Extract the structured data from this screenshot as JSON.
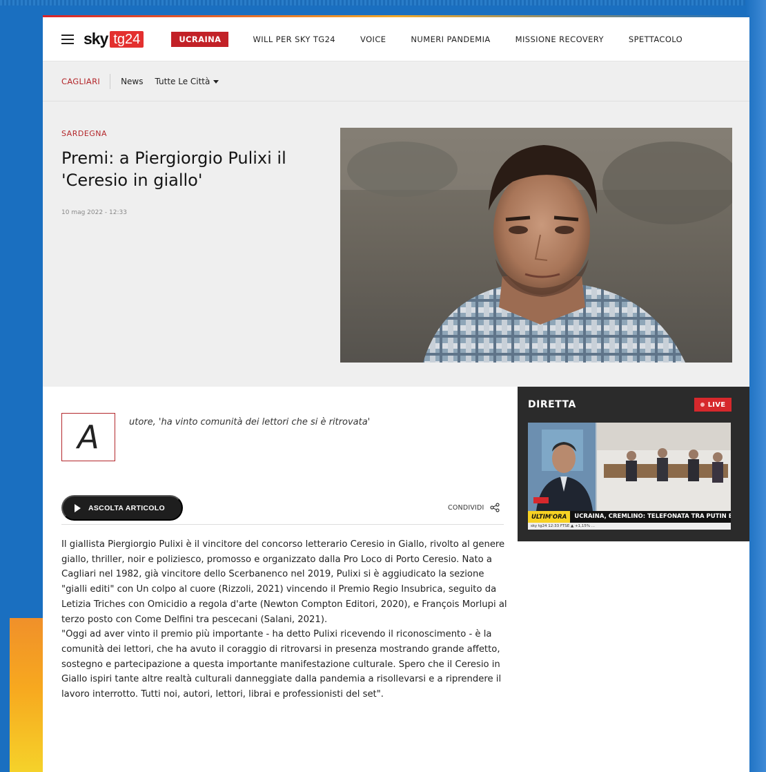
{
  "nav": {
    "logo_sky": "sky",
    "logo_tg": "tg24",
    "items": [
      {
        "label": "UCRAINA"
      },
      {
        "label": "WILL PER SKY TG24"
      },
      {
        "label": "VOICE"
      },
      {
        "label": "NUMERI PANDEMIA"
      },
      {
        "label": "MISSIONE RECOVERY"
      },
      {
        "label": "SPETTACOLO"
      }
    ]
  },
  "subnav": {
    "city": "CAGLIARI",
    "news": "News",
    "cities": "Tutte Le Città"
  },
  "article": {
    "kicker": "SARDEGNA",
    "title": "Premi: a Piergiorgio Pulixi il 'Ceresio in giallo'",
    "date": "10 mag 2022 - 12:33",
    "dropcap": "A",
    "summary": "utore, 'ha vinto comunità dei lettori che si è ritrovata'",
    "listen_label": "ASCOLTA ARTICOLO",
    "share_label": "CONDIVIDI",
    "paragraphs": [
      "Il giallista Piergiorgio Pulixi è il vincitore del concorso letterario Ceresio in Giallo, rivolto al genere giallo, thriller, noir e poliziesco, promosso e organizzato dalla Pro Loco di Porto Ceresio. Nato a Cagliari nel 1982, già vincitore dello Scerbanenco nel 2019, Pulixi si è aggiudicato la sezione \"gialli editi\" con Un colpo al cuore (Rizzoli, 2021) vincendo il Premio Regio Insubrica, seguito da Letizia Triches con Omicidio a regola d'arte (Newton Compton Editori, 2020), e François Morlupi al terzo posto con Come Delfini tra pescecani (Salani, 2021).",
      "\"Oggi ad aver vinto il premio più importante - ha detto Pulixi ricevendo il riconoscimento - è la comunità dei lettori, che ha avuto il coraggio di ritrovarsi in presenza mostrando grande affetto, sostegno e partecipazione a questa importante manifestazione culturale. Spero che il Ceresio in Giallo ispiri tante altre realtà culturali danneggiate dalla pandemia a risollevarsi e a riprendere il lavoro interrotto. Tutti noi, autori, lettori, librai e professionisti del set\"."
    ]
  },
  "live": {
    "title": "DIRETTA",
    "badge": "LIVE",
    "ticker_label": "ULTIM'ORA",
    "ticker_text": "UCRAINA, CREMLINO: TELEFONATA TRA PUTIN E SCHOLZ",
    "ticker_bottom": "sky tg24  12:33  FTSE ▲ +1,15%  ..."
  },
  "colors": {
    "accent_red": "#c22127",
    "live_red": "#d6282c",
    "ticker_yellow": "#f7d223",
    "page_bg": "#1a6fc0"
  }
}
